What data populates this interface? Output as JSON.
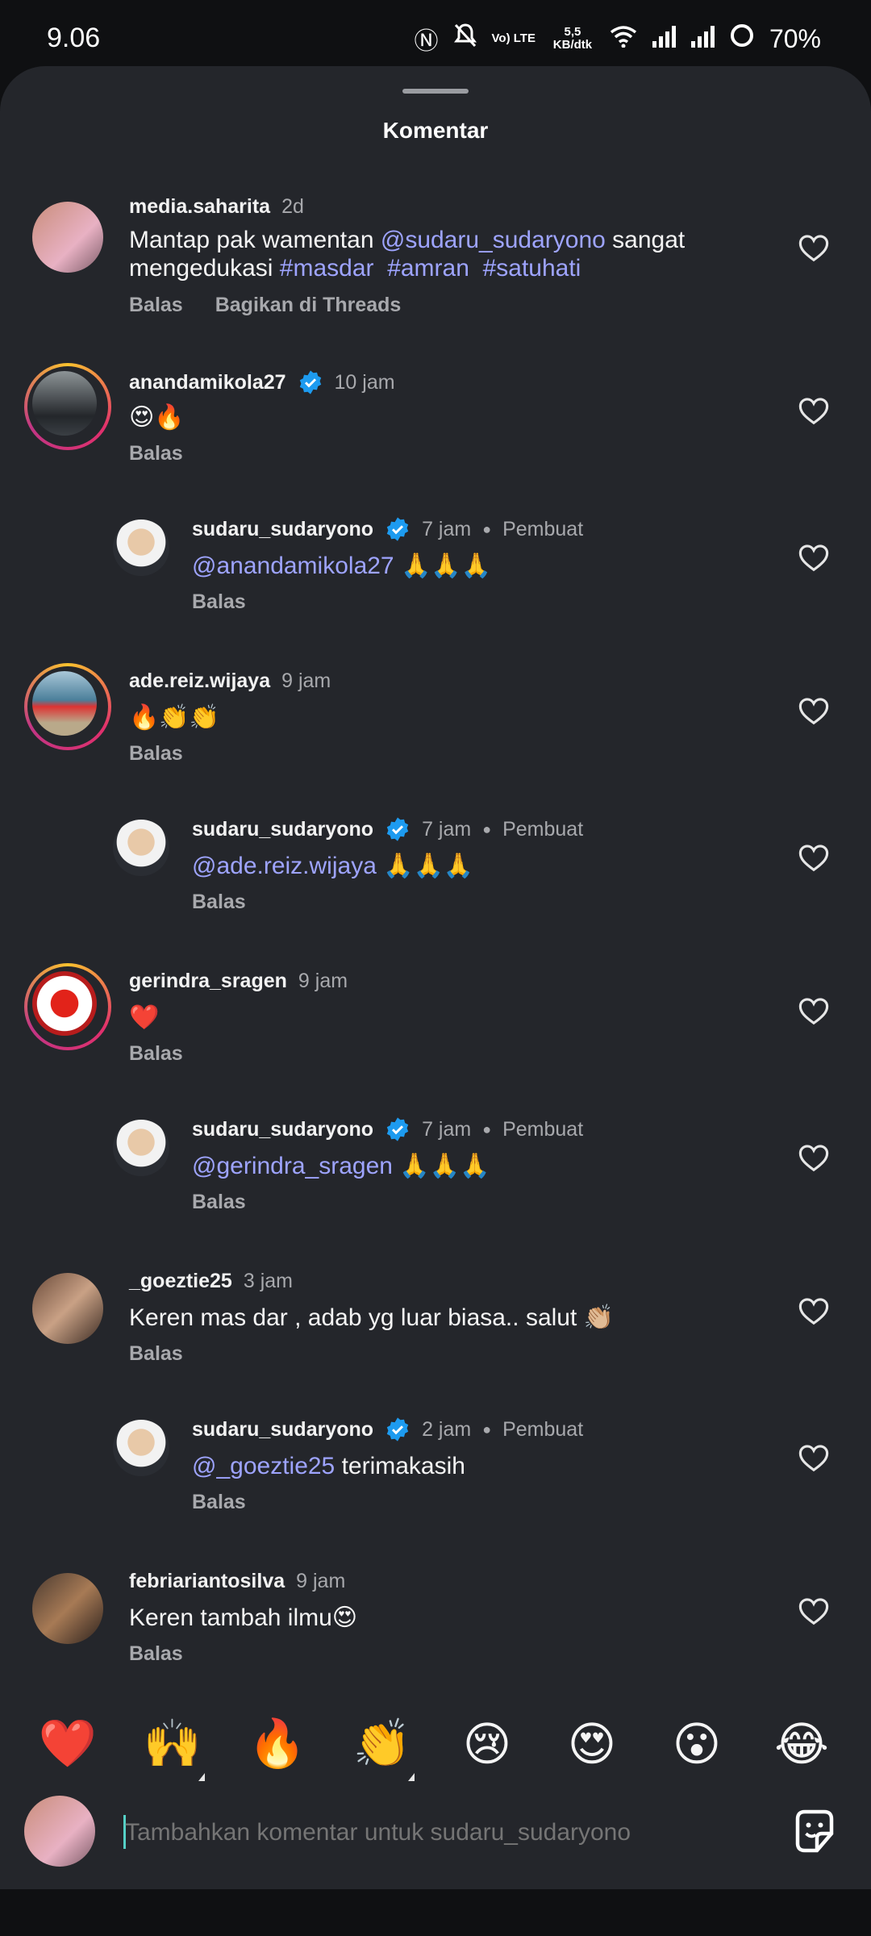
{
  "status": {
    "time": "9.06",
    "volte": "Vo) LTE",
    "net_speed": "5,5 KB/dtk",
    "battery": "70%"
  },
  "sheet_title": "Komentar",
  "labels": {
    "reply": "Balas",
    "share_threads": "Bagikan di Threads",
    "creator": "Pembuat"
  },
  "comments": [
    {
      "user": "media.saharita",
      "time": "2d",
      "verified": false,
      "creator": false,
      "text_parts": [
        "Mantap pak wamentan ",
        "@sudaru_sudaryono",
        " sangat",
        "mengedukasi ",
        "#masdar",
        "  ",
        "#amran",
        "  ",
        "#satuhati"
      ]
    },
    {
      "user": "anandamikola27",
      "time": "10 jam",
      "verified": true,
      "creator": false,
      "text": "😍🔥"
    },
    {
      "user": "sudaru_sudaryono",
      "time": "7 jam",
      "verified": true,
      "creator": true,
      "mention": "@anandamikola27",
      "text": " 🙏🙏🙏"
    },
    {
      "user": "ade.reiz.wijaya",
      "time": "9 jam",
      "verified": false,
      "creator": false,
      "text": "🔥👏👏"
    },
    {
      "user": "sudaru_sudaryono",
      "time": "7 jam",
      "verified": true,
      "creator": true,
      "mention": "@ade.reiz.wijaya",
      "text": " 🙏🙏🙏"
    },
    {
      "user": "gerindra_sragen",
      "time": "9 jam",
      "verified": false,
      "creator": false,
      "text": "❤️"
    },
    {
      "user": "sudaru_sudaryono",
      "time": "7 jam",
      "verified": true,
      "creator": true,
      "mention": "@gerindra_sragen",
      "text": " 🙏🙏🙏"
    },
    {
      "user": "_goeztie25",
      "time": "3 jam",
      "verified": false,
      "creator": false,
      "text": "Keren mas dar , adab yg luar biasa.. salut 👏🏼"
    },
    {
      "user": "sudaru_sudaryono",
      "time": "2 jam",
      "verified": true,
      "creator": true,
      "mention": "@_goeztie25",
      "text": " terimakasih"
    },
    {
      "user": "febriariantosilva",
      "time": "9 jam",
      "verified": false,
      "creator": false,
      "text": "Keren tambah ilmu😍"
    }
  ],
  "quick_emojis": [
    "❤️",
    "🙌",
    "🔥",
    "👏",
    "😢",
    "😍",
    "😮",
    "😂"
  ],
  "input": {
    "placeholder": "Tambahkan komentar untuk sudaru_sudaryono"
  },
  "colors": {
    "sheet_bg": "#24262b",
    "mention": "#9ea4ff",
    "verified": "#1d9bf0"
  }
}
